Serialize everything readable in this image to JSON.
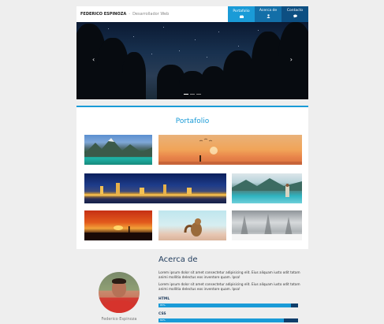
{
  "header": {
    "brand_name": "FEDERICO ESPINOZA",
    "brand_separator": "-",
    "brand_role": "Desarrollador Web",
    "nav": [
      {
        "label": "Portafolio",
        "icon": "briefcase-icon"
      },
      {
        "label": "Acerca de",
        "icon": "user-icon"
      },
      {
        "label": "Contacto",
        "icon": "chat-icon"
      }
    ]
  },
  "hero": {
    "prev_arrow": "‹",
    "next_arrow": "›",
    "slides": 3,
    "active_slide": 1
  },
  "portfolio": {
    "title": "Portafolio"
  },
  "about": {
    "title": "Acerca de",
    "name": "Federico Espinoza",
    "paragraph1": "Lorem ipsum dolor sit amet consectetur adipisicing elit. Eius aliquam iusto odit totam animi mollitia delectus eos inventore quam. Ipsa!",
    "paragraph2": "Lorem ipsum dolor sit amet consectetur adipisicing elit. Eius aliquam iusto odit totam animi mollitia delectus eos inventore quam. Ipsa!",
    "skills": [
      {
        "name": "HTML",
        "percent_label": "85%",
        "level": 0.95
      },
      {
        "name": "CSS",
        "percent_label": "80%",
        "level": 0.9
      }
    ]
  },
  "colors": {
    "accent": "#1a9bd7",
    "nav_mid": "#136fa8",
    "nav_dark": "#0d4f82",
    "bar_track": "#0f3e6b"
  }
}
